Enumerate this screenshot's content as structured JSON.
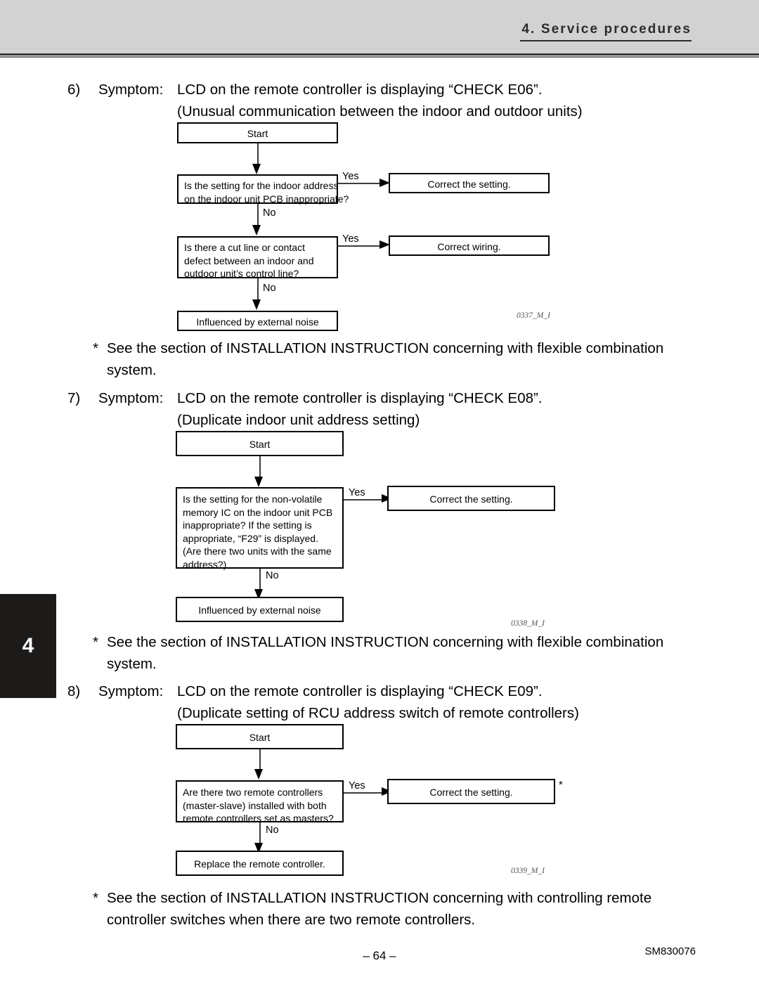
{
  "header": {
    "title": "4. Service procedures"
  },
  "section_tab": {
    "number": "4"
  },
  "symptoms": [
    {
      "number": "6)",
      "label": "Symptom:",
      "line1": "LCD on the remote controller is displaying “CHECK E06”.",
      "line2": "(Unusual communication between the indoor and outdoor units)"
    },
    {
      "number": "7)",
      "label": "Symptom:",
      "line1": "LCD on the remote controller is displaying “CHECK E08”.",
      "line2": "(Duplicate indoor unit address setting)"
    },
    {
      "number": "8)",
      "label": "Symptom:",
      "line1": "LCD on the remote controller is displaying “CHECK E09”.",
      "line2": "(Duplicate setting of RCU address switch of remote controllers)"
    }
  ],
  "notes": [
    {
      "marker": "*",
      "line1": "See the section of INSTALLATION INSTRUCTION concerning with flexible combination",
      "line2": "system."
    },
    {
      "marker": "*",
      "line1": "See the section of INSTALLATION INSTRUCTION concerning with flexible combination",
      "line2": "system."
    },
    {
      "marker": "*",
      "line1": "See the section of INSTALLATION INSTRUCTION concerning with controlling remote",
      "line2": "controller switches when there are two remote controllers."
    }
  ],
  "flowcharts": [
    {
      "figure_id": "0337_M_I",
      "start": "Start",
      "decision1": {
        "line1": "Is the setting for the indoor address",
        "line2": "on the indoor unit PCB inappropriate?",
        "yes_label": "Yes",
        "no_label": "No",
        "yes_result": "Correct the setting."
      },
      "decision2": {
        "line1": "Is there a cut line or contact",
        "line2": "defect between an indoor and",
        "line3": "outdoor unit’s control line?",
        "yes_label": "Yes",
        "no_label": "No",
        "yes_result": "Correct wiring."
      },
      "terminal": "Influenced by external noise"
    },
    {
      "figure_id": "0338_M_I",
      "start": "Start",
      "decision1": {
        "line1": " Is the setting for the non-volatile",
        "line2": "memory IC on the indoor unit PCB",
        "line3": "inappropriate? If the setting is",
        "line4": "appropriate, “F29” is displayed.",
        "line5": "(Are there two units with the same",
        "line6": "address?)",
        "yes_label": "Yes",
        "no_label": "No",
        "yes_result": "Correct the setting."
      },
      "terminal": "Influenced by external noise"
    },
    {
      "figure_id": "0339_M_I",
      "start": "Start",
      "decision1": {
        "line1": "Are there two remote controllers",
        "line2": "(master-slave) installed with both",
        "line3": "remote controllers set as masters?",
        "yes_label": "Yes",
        "no_label": "No",
        "yes_result": "Correct the setting.",
        "yes_result_asterisk": "*"
      },
      "terminal": "Replace the remote controller."
    }
  ],
  "footer": {
    "page_number": "– 64 –",
    "doc_code": "SM830076"
  }
}
